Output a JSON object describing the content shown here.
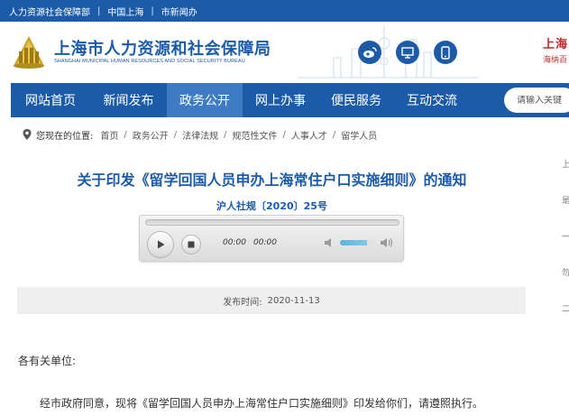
{
  "topbar": {
    "links": [
      "人力资源社会保障部",
      "中国上海",
      "市新闻办"
    ],
    "separator": "|"
  },
  "header": {
    "title": "上海市人力资源和社会保障局",
    "subtitle": "SHANGHAI MUNICIPAL HUMAN RESOURCES AND SOCIAL SECURITY BUREAU",
    "right_title": "上海",
    "right_subtitle": "海纳百",
    "social_icons": [
      "weibo-icon",
      "monitor-icon",
      "mobile-icon"
    ]
  },
  "nav": {
    "items": [
      "网站首页",
      "新闻发布",
      "政务公开",
      "网上办事",
      "便民服务",
      "互动交流"
    ],
    "active_index": 2,
    "search_placeholder": "请输入关键"
  },
  "breadcrumb": {
    "label": "您现在的位置:",
    "items": [
      "首页",
      "政务公开",
      "法律法规",
      "规范性文件",
      "人事人才",
      "留学人员"
    ],
    "separator": "/"
  },
  "article": {
    "title": "关于印发《留学回国人员申办上海常住户口实施细则》的通知",
    "doc_number": "沪人社规〔2020〕25号",
    "player": {
      "current_time": "00:00",
      "duration": "00:00",
      "volume_fraction": 0.75
    },
    "publish_label": "发布时间:",
    "publish_date": "2020-11-13",
    "salutation": "各有关单位:",
    "paragraph": "经市政府同意，现将《留学回国人员申办上海常住户口实施细则》印发给你们，请遵照执行。"
  },
  "right_edge": [
    "上",
    "是",
    "一",
    "勿",
    "二"
  ],
  "colors": {
    "primary_blue": "#1c5ba8",
    "active_nav": "#3f7ac4",
    "accent_red": "#c1272d"
  }
}
